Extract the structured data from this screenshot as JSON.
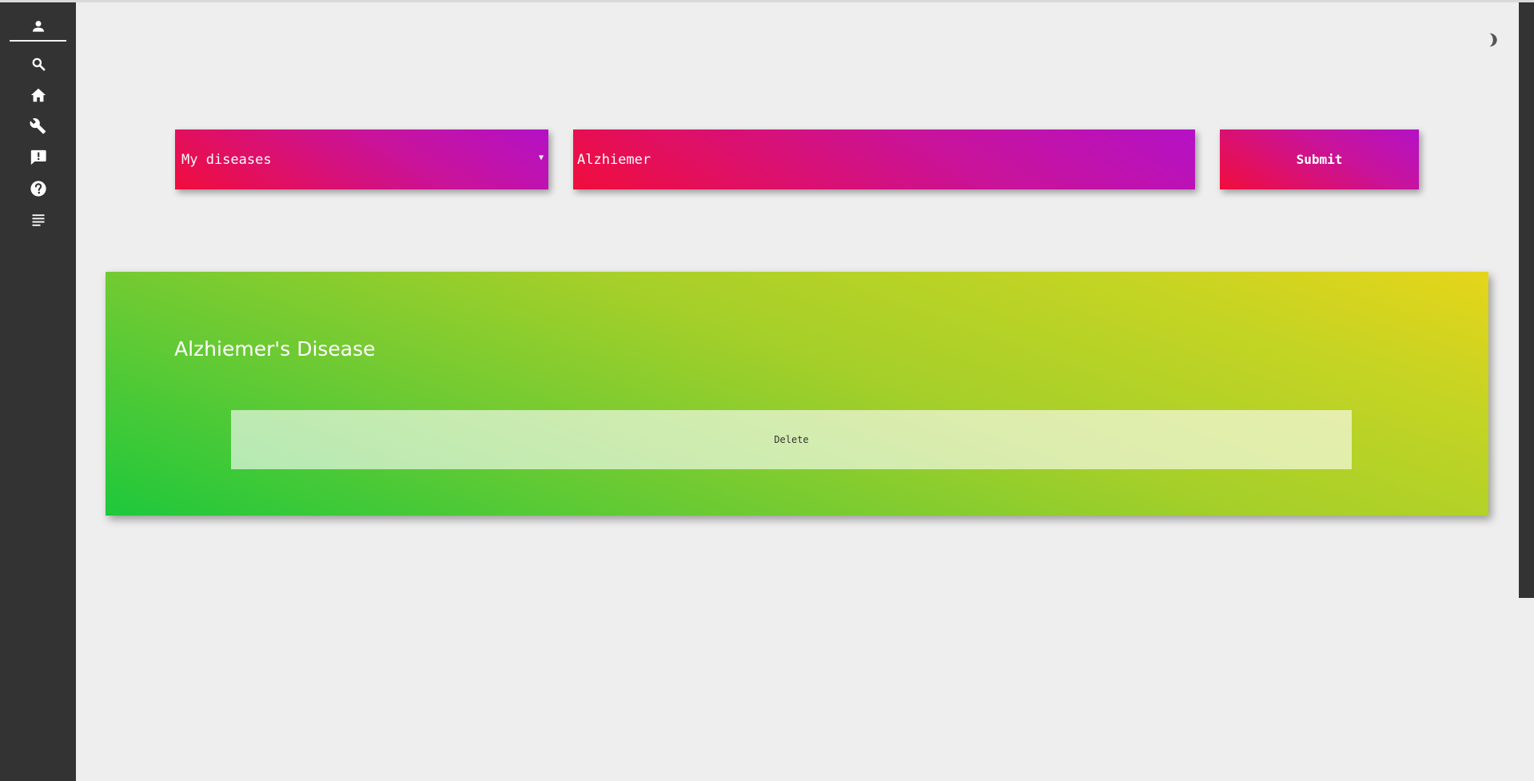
{
  "sidebar": {
    "items": [
      {
        "icon": "user-icon"
      },
      {
        "icon": "search-icon"
      },
      {
        "icon": "home-icon"
      },
      {
        "icon": "wrench-icon"
      },
      {
        "icon": "feedback-icon"
      },
      {
        "icon": "help-icon"
      },
      {
        "icon": "notes-icon"
      }
    ]
  },
  "theme_toggle": {
    "icon": "moon-icon"
  },
  "form": {
    "select_value": "My diseases",
    "input_value": "Alzhiemer",
    "submit_label": "Submit"
  },
  "card": {
    "title": "Alzhiemer's Disease",
    "delete_label": "Delete"
  },
  "colors": {
    "sidebar": "#333333",
    "background": "#eeeeee",
    "pink_start": "#f00d3c",
    "pink_end": "#b411c6",
    "green_start": "#1ec83c",
    "yellow_end": "#e5d51a"
  }
}
